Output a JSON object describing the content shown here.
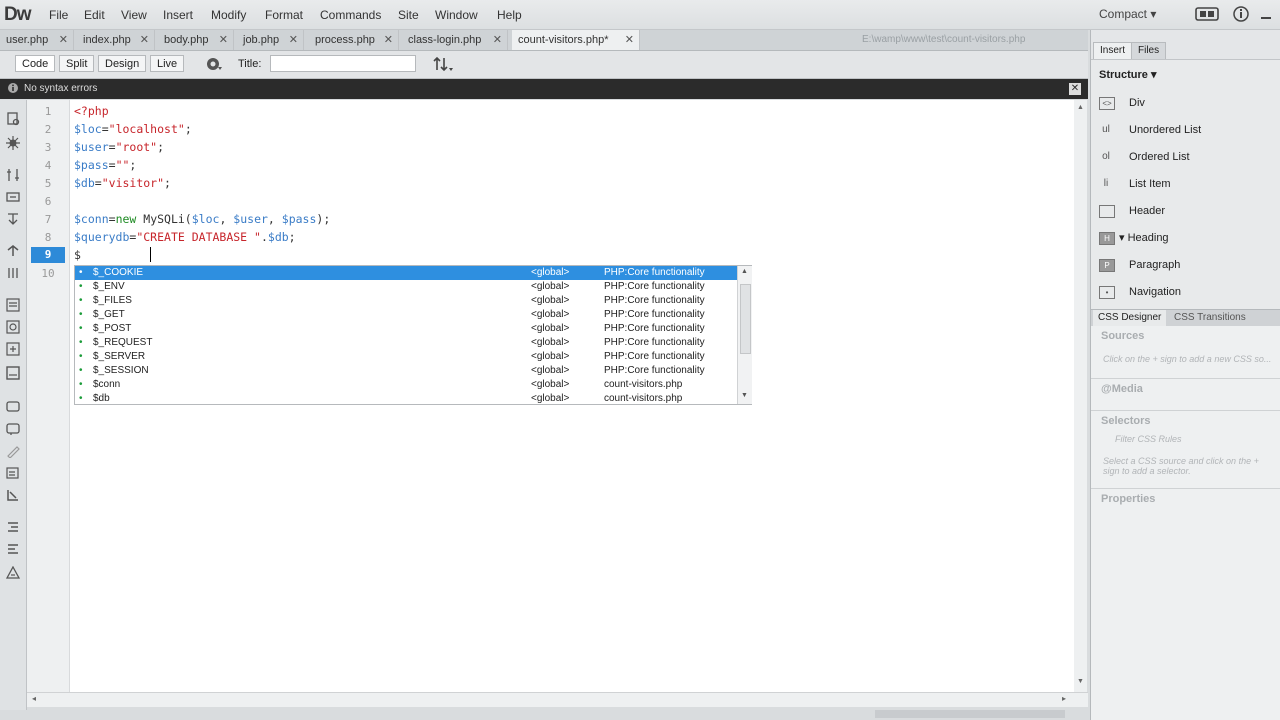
{
  "app": {
    "logo": "Dw",
    "layout_switch": "Compact ▾"
  },
  "menu": [
    "File",
    "Edit",
    "View",
    "Insert",
    "Modify",
    "Format",
    "Commands",
    "Site",
    "Window",
    "Help"
  ],
  "tabs": [
    {
      "label": "user.php"
    },
    {
      "label": "index.php"
    },
    {
      "label": "body.php"
    },
    {
      "label": "job.php"
    },
    {
      "label": "process.php"
    },
    {
      "label": "class-login.php"
    },
    {
      "label": "count-visitors.php*"
    }
  ],
  "filepath": "E:\\wamp\\www\\test\\count-visitors.php",
  "doc_toolbar": {
    "code": "Code",
    "split": "Split",
    "design": "Design",
    "live": "Live",
    "title_label": "Title:",
    "title_value": ""
  },
  "syntax_status": "No syntax errors",
  "editor": {
    "line_numbers": [
      "1",
      "2",
      "3",
      "4",
      "5",
      "6",
      "7",
      "8",
      "9",
      "10"
    ],
    "current_line": "9",
    "lines": [
      [
        {
          "c": "tag",
          "t": "<?php"
        }
      ],
      [
        {
          "c": "var",
          "t": "$loc"
        },
        {
          "c": "pl",
          "t": "="
        },
        {
          "c": "str",
          "t": "\"localhost\""
        },
        {
          "c": "pl",
          "t": ";"
        }
      ],
      [
        {
          "c": "var",
          "t": "$user"
        },
        {
          "c": "pl",
          "t": "="
        },
        {
          "c": "str",
          "t": "\"root\""
        },
        {
          "c": "pl",
          "t": ";"
        }
      ],
      [
        {
          "c": "var",
          "t": "$pass"
        },
        {
          "c": "pl",
          "t": "="
        },
        {
          "c": "str",
          "t": "\"\""
        },
        {
          "c": "pl",
          "t": ";"
        }
      ],
      [
        {
          "c": "var",
          "t": "$db"
        },
        {
          "c": "pl",
          "t": "="
        },
        {
          "c": "str",
          "t": "\"visitor\""
        },
        {
          "c": "pl",
          "t": ";"
        }
      ],
      [],
      [
        {
          "c": "var",
          "t": "$conn"
        },
        {
          "c": "pl",
          "t": "="
        },
        {
          "c": "kw",
          "t": "new"
        },
        {
          "c": "pl",
          "t": " MySQLi("
        },
        {
          "c": "var",
          "t": "$loc"
        },
        {
          "c": "pl",
          "t": ", "
        },
        {
          "c": "var",
          "t": "$user"
        },
        {
          "c": "pl",
          "t": ", "
        },
        {
          "c": "var",
          "t": "$pass"
        },
        {
          "c": "pl",
          "t": ");"
        }
      ],
      [
        {
          "c": "var",
          "t": "$querydb"
        },
        {
          "c": "pl",
          "t": "="
        },
        {
          "c": "str",
          "t": "\"CREATE DATABASE \""
        },
        {
          "c": "pl",
          "t": "."
        },
        {
          "c": "var",
          "t": "$db"
        },
        {
          "c": "pl",
          "t": ";"
        }
      ],
      [
        {
          "c": "pl",
          "t": "$"
        }
      ],
      []
    ]
  },
  "code_hints": [
    {
      "name": "$_COOKIE",
      "scope": "<global>",
      "type": "PHP:Core functionality"
    },
    {
      "name": "$_ENV",
      "scope": "<global>",
      "type": "PHP:Core functionality"
    },
    {
      "name": "$_FILES",
      "scope": "<global>",
      "type": "PHP:Core functionality"
    },
    {
      "name": "$_GET",
      "scope": "<global>",
      "type": "PHP:Core functionality"
    },
    {
      "name": "$_POST",
      "scope": "<global>",
      "type": "PHP:Core functionality"
    },
    {
      "name": "$_REQUEST",
      "scope": "<global>",
      "type": "PHP:Core functionality"
    },
    {
      "name": "$_SERVER",
      "scope": "<global>",
      "type": "PHP:Core functionality"
    },
    {
      "name": "$_SESSION",
      "scope": "<global>",
      "type": "PHP:Core functionality"
    },
    {
      "name": "$conn",
      "scope": "<global>",
      "type": "count-visitors.php"
    },
    {
      "name": "$db",
      "scope": "<global>",
      "type": "count-visitors.php"
    }
  ],
  "right_panel": {
    "tabs": {
      "insert": "Insert",
      "files": "Files"
    },
    "category": "Structure",
    "insert_items": [
      {
        "icon": "div-icon",
        "glyph": "<>",
        "label": "Div"
      },
      {
        "icon": "unordered-list-icon",
        "glyph": "ul",
        "label": "Unordered List"
      },
      {
        "icon": "ordered-list-icon",
        "glyph": "ol",
        "label": "Ordered List"
      },
      {
        "icon": "list-item-icon",
        "glyph": "li",
        "label": "List Item"
      },
      {
        "icon": "header-icon",
        "glyph": "",
        "label": "Header"
      },
      {
        "icon": "heading-icon",
        "glyph": "H",
        "label": "▾ Heading"
      },
      {
        "icon": "paragraph-icon",
        "glyph": "P",
        "label": "Paragraph"
      },
      {
        "icon": "navigation-icon",
        "glyph": "•",
        "label": "Navigation"
      }
    ],
    "css_tabs": {
      "designer": "CSS Designer",
      "transitions": "CSS Transitions"
    },
    "sources": "Sources",
    "sources_hint": "Click on the + sign to add a new CSS so...",
    "media": "@Media",
    "selectors": "Selectors",
    "filter_placeholder": "Filter CSS Rules",
    "selectors_hint": "Select a CSS source and click on the + sign to add a selector.",
    "properties": "Properties"
  }
}
